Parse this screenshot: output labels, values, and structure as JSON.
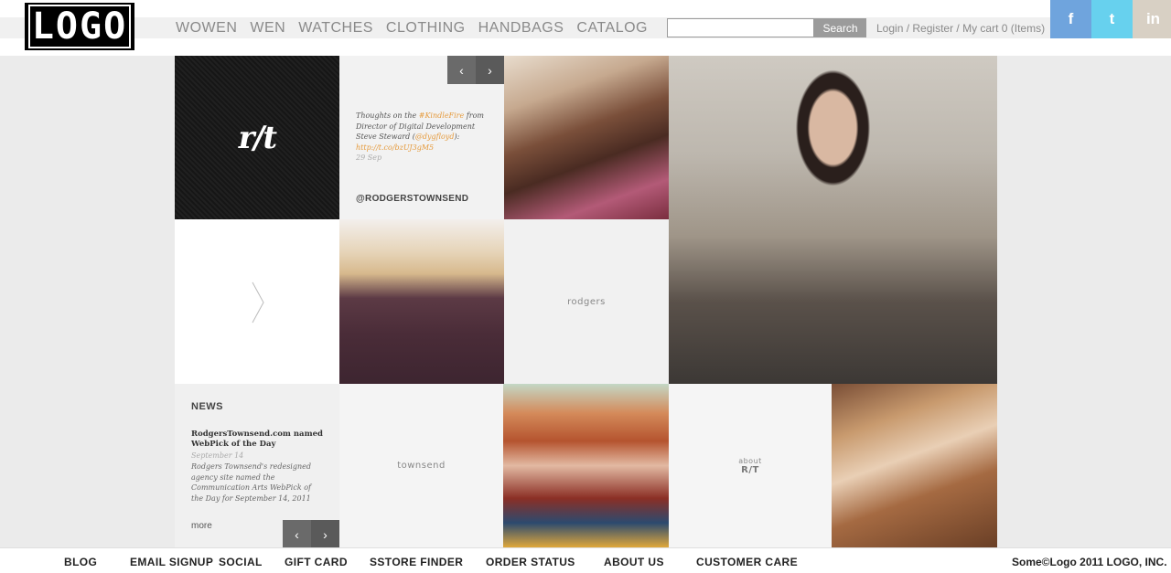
{
  "header": {
    "logo_text": "LOGO",
    "nav": [
      "WOWEN",
      "WEN",
      "WATCHES",
      "CLOTHING",
      "HANDBAGS",
      "CATALOG"
    ],
    "search_button": "Search",
    "login": "Login",
    "register": "Register",
    "cart": "My cart 0 (Items)",
    "social": {
      "facebook": "f",
      "twitter": "t",
      "linkedin": "in"
    }
  },
  "tweet": {
    "text_pre": "Thoughts on the ",
    "hashtag": "#KindleFire",
    "text_mid": " from Director of Digital Development Steve Steward (",
    "mention": "@dygfloyd",
    "text_post": "):",
    "link": "http://t.co/bzUJ3gM5",
    "date": "29 Sep",
    "handle": "@RODGERSTOWNSEND"
  },
  "tiles": {
    "rodgers": "rodgers",
    "townsend": "townsend",
    "about_small": "about",
    "about_big": "R/T"
  },
  "news": {
    "heading": "NEWS",
    "title": "RodgersTownsend.com named WebPick of the Day",
    "date": "September 14",
    "body": "Rodgers Townsend's redesigned agency site named the Communication Arts WebPick of the Day for September 14, 2011",
    "more": "more"
  },
  "footer": {
    "links": [
      "BLOG",
      "EMAIL SIGNUP",
      "SOCIAL",
      "GIFT CARD",
      "SSTORE FINDER",
      "ORDER STATUS",
      "ABOUT US",
      "CUSTOMER CARE"
    ],
    "copyright": "Some©Logo 2011 LOGO, INC."
  },
  "colors": {
    "accent": "#e59a3c",
    "facebook": "#6fa4dd",
    "twitter": "#67d1ee",
    "linkedin": "#d8d0c4"
  }
}
